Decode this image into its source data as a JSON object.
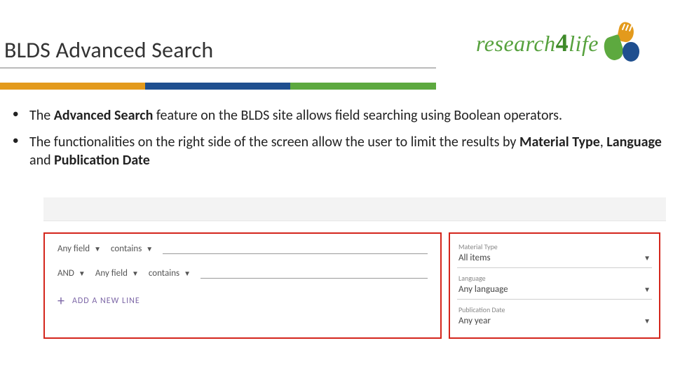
{
  "header": {
    "title": "BLDS Advanced Search",
    "logo_text_pre": "research",
    "logo_text_four": "4",
    "logo_text_post": "life"
  },
  "bullets": {
    "b1_pre": "The ",
    "b1_bold": "Advanced Search ",
    "b1_post": "feature on the BLDS site allows field searching using Boolean operators.",
    "b2_pre": "The functionalities on the right side of the screen allow the user to limit the results by ",
    "b2_bold1": "Material Type",
    "b2_mid1": ", ",
    "b2_bold2": "Language ",
    "b2_mid2": "and ",
    "b2_bold3": "Publication Date"
  },
  "screenshot": {
    "row1": {
      "field": "Any field",
      "op": "contains"
    },
    "row2": {
      "bool": "AND",
      "field": "Any field",
      "op": "contains"
    },
    "addline": "ADD A NEW LINE",
    "filters": {
      "material": {
        "label": "Material Type",
        "value": "All items"
      },
      "language": {
        "label": "Language",
        "value": "Any language"
      },
      "pubdate": {
        "label": "Publication Date",
        "value": "Any year"
      }
    }
  }
}
